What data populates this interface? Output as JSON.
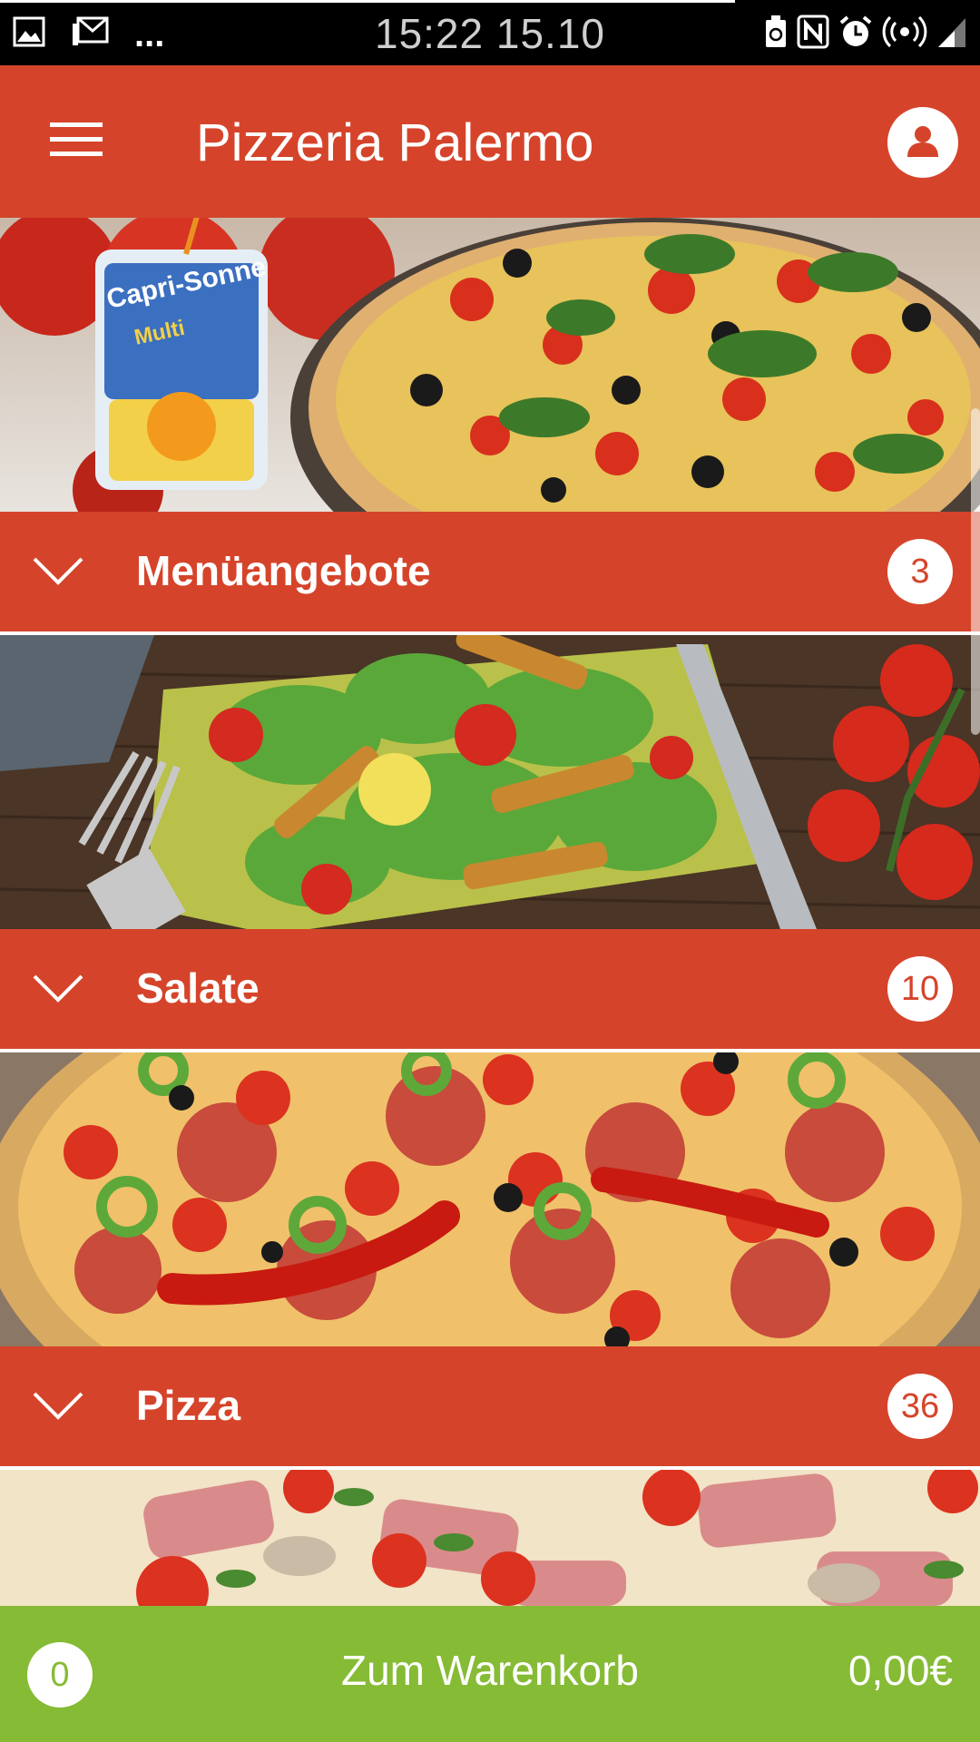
{
  "status_bar": {
    "time": "15:22 15.10",
    "ellipsis": "...",
    "left_icons": [
      "gallery-icon",
      "mail-icon"
    ],
    "right_icons": [
      "recycle-battery-icon",
      "nfc-icon",
      "alarm-icon",
      "hotspot-icon",
      "signal-icon"
    ]
  },
  "app_bar": {
    "title": "Pizzeria Palermo",
    "menu_icon": "hamburger-menu-icon",
    "profile_icon": "user-icon"
  },
  "categories": [
    {
      "label": "Menüangebote",
      "count": "3",
      "image": "drink-and-pizza-photo"
    },
    {
      "label": "Salate",
      "count": "10",
      "image": "salad-photo"
    },
    {
      "label": "Pizza",
      "count": "36",
      "image": "salami-pizza-photo"
    },
    {
      "image": "ham-pizza-photo"
    }
  ],
  "cart": {
    "count": "0",
    "label": "Zum Warenkorb",
    "total": "0,00€"
  },
  "colors": {
    "accent_red": "#d5442a",
    "cart_green": "#86bb35",
    "status_bar": "#000000"
  }
}
